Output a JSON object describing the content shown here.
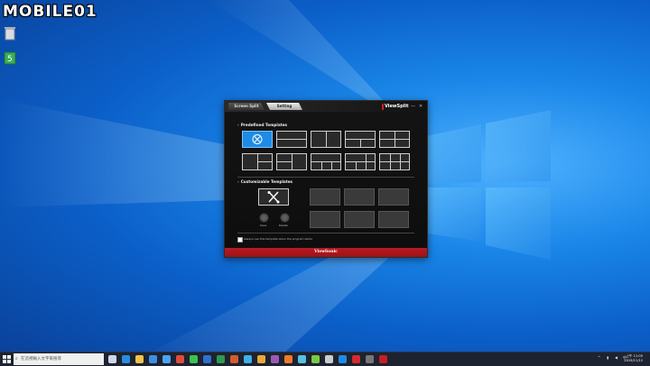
{
  "watermark": {
    "text": "MOBILE01"
  },
  "app": {
    "tabs": [
      {
        "label": "Screen Split",
        "active": false
      },
      {
        "label": "Setting",
        "active": true
      }
    ],
    "brand": "ViewSplit",
    "window_controls": {
      "minimize": "—",
      "close": "✕"
    },
    "predefined": {
      "heading": "Predefined Templates",
      "templates": [
        {
          "name": "none",
          "selected": true
        },
        {
          "name": "2-rows"
        },
        {
          "name": "2-cols"
        },
        {
          "name": "1-top-2-bottom"
        },
        {
          "name": "2x2"
        },
        {
          "name": "1-left-2-right"
        },
        {
          "name": "2-left-1-right"
        },
        {
          "name": "3-cols"
        },
        {
          "name": "1-top-3-bottom"
        },
        {
          "name": "3x2"
        }
      ]
    },
    "custom": {
      "heading": "Customizable Templates",
      "save_label": "Save",
      "delete_label": "Delete",
      "slots": 6
    },
    "checkbox": {
      "label": "Always use this template when the program starts",
      "checked": false
    },
    "footer": "ViewSonic"
  },
  "taskbar": {
    "search_placeholder": "在這裡輸入文字來搜尋",
    "clock": {
      "time": "上午 11:05",
      "date": "2019/11/12"
    },
    "tray": {
      "language": "中"
    },
    "icons": [
      {
        "name": "task-view-icon",
        "color": "#cfd6e6"
      },
      {
        "name": "edge-icon",
        "color": "#2b8be0"
      },
      {
        "name": "file-explorer-icon",
        "color": "#f2c14e"
      },
      {
        "name": "store-icon",
        "color": "#3b8fe6"
      },
      {
        "name": "mail-icon",
        "color": "#4aa3f0"
      },
      {
        "name": "chrome-icon",
        "color": "#e24b3b"
      },
      {
        "name": "line-icon",
        "color": "#3cc24f"
      },
      {
        "name": "word-icon",
        "color": "#2f6fd0"
      },
      {
        "name": "excel-icon",
        "color": "#2f9a4f"
      },
      {
        "name": "powerpoint-icon",
        "color": "#d55a2e"
      },
      {
        "name": "photos-icon",
        "color": "#3fb0e8"
      },
      {
        "name": "app-icon-1",
        "color": "#e8a83a"
      },
      {
        "name": "app-icon-2",
        "color": "#9b59b6"
      },
      {
        "name": "firefox-icon",
        "color": "#ef7a2b"
      },
      {
        "name": "app-icon-3",
        "color": "#56c1e0"
      },
      {
        "name": "app-icon-4",
        "color": "#7ac943"
      },
      {
        "name": "app-icon-5",
        "color": "#cccccc"
      },
      {
        "name": "app-icon-6",
        "color": "#1e8be6"
      },
      {
        "name": "acrobat-icon",
        "color": "#d62b2b"
      },
      {
        "name": "app-icon-7",
        "color": "#777777"
      },
      {
        "name": "viewsplit-icon",
        "color": "#c81d25"
      }
    ]
  }
}
